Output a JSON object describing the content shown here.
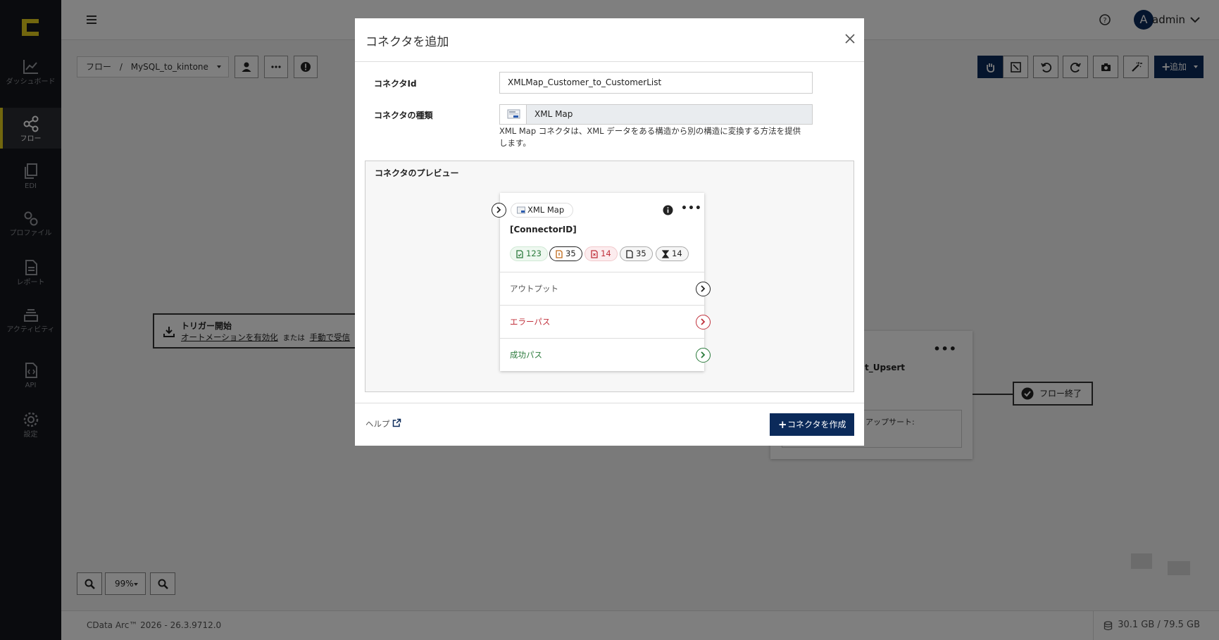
{
  "sidebar": {
    "items": [
      {
        "label": "ダッシュボード",
        "icon": "chart-line-icon"
      },
      {
        "label": "フロー",
        "icon": "share-nodes-icon",
        "active": true
      },
      {
        "label": "EDI",
        "icon": "documents-icon"
      },
      {
        "label": "プロファイル",
        "icon": "gears-icon"
      },
      {
        "label": "レポート",
        "icon": "report-icon"
      },
      {
        "label": "アクティビティ",
        "icon": "layers-icon"
      },
      {
        "label": "API",
        "icon": "api-file-icon"
      },
      {
        "label": "設定",
        "icon": "gear-icon"
      }
    ]
  },
  "header": {
    "user_initial": "A",
    "user_name": "admin"
  },
  "toolbar": {
    "breadcrumb_root": "フロー",
    "breadcrumb_sep": "/",
    "flow_name": "MySQL_to_kintone",
    "add_label": "追加"
  },
  "canvas": {
    "trigger_title": "トリガー開始",
    "trigger_link1": "オートメーションを有効化",
    "trigger_or": "または",
    "trigger_link2": "手動で受信",
    "bg_node_title": "t_Upsert",
    "bg_node_inner": "アップサート:",
    "end_node": "フロー終了",
    "zoom_level": "99%"
  },
  "footer": {
    "version": "CData Arc™ 2026 - 26.3.9712.0",
    "disk": "30.1 GB / 79.5 GB"
  },
  "modal": {
    "title": "コネクタを追加",
    "id_label": "コネクタId",
    "id_value": "XMLMap_Customer_to_CustomerList",
    "type_label": "コネクタの種類",
    "type_value": "XML Map",
    "description_line1": "XML Map コネクタは、XML データをある構造から別の構造に変換する方法を提供",
    "description_line2": "します。",
    "preview_label": "コネクタのプレビュー",
    "preview": {
      "chip_label": "XML Map",
      "connector_id": "[ConnectorID]",
      "badges": [
        "123",
        "35",
        "14",
        "35",
        "14"
      ],
      "output_label": "アウトプット",
      "error_label": "エラーパス",
      "success_label": "成功パス"
    },
    "help_label": "ヘルプ",
    "create_label": "コネクタを作成"
  },
  "colors": {
    "sidebar_bg": "#15171c",
    "accent_yellow": "#e5cf1d",
    "primary": "#0b2a5a",
    "success": "#2a7a3b",
    "error": "#c0303b"
  }
}
